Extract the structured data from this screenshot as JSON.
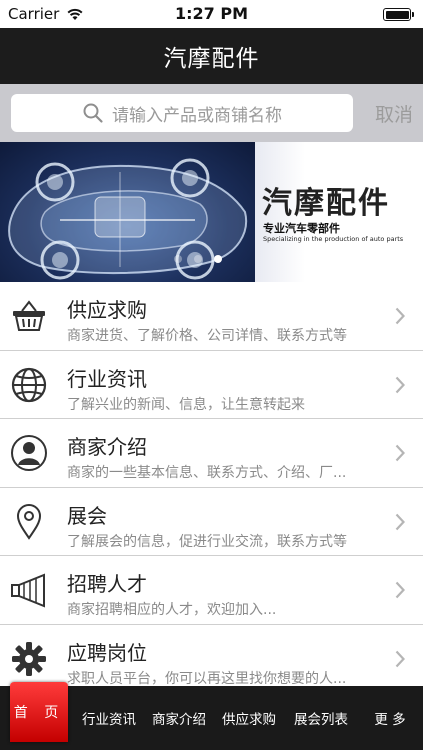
{
  "status_bar": {
    "carrier": "Carrier",
    "time": "1:27 PM"
  },
  "nav": {
    "title": "汽摩配件"
  },
  "search": {
    "placeholder": "请输入产品或商铺名称",
    "cancel_label": "取消"
  },
  "banner": {
    "brand_title": "汽摩配件",
    "brand_subtitle": "专业汽车零部件",
    "brand_english": "Specializing in the production of auto parts",
    "page_count": 3,
    "active_page_index": 2
  },
  "list": [
    {
      "title": "供应求购",
      "desc": "商家进货、了解价格、公司详情、联系方式等",
      "icon": "basket-icon"
    },
    {
      "title": "行业资讯",
      "desc": "了解兴业的新闻、信息，让生意转起来",
      "icon": "globe-icon"
    },
    {
      "title": "商家介绍",
      "desc": "商家的一些基本信息、联系方式、介绍、厂...",
      "icon": "person-icon"
    },
    {
      "title": "展会",
      "desc": "了解展会的信息，促进行业交流，联系方式等",
      "icon": "location-pin-icon"
    },
    {
      "title": "招聘人才",
      "desc": "商家招聘相应的人才，欢迎加入...",
      "icon": "megaphone-icon"
    },
    {
      "title": "应聘岗位",
      "desc": "求职人员平台，你可以再这里找你想要的人...",
      "icon": "gear-icon"
    }
  ],
  "tabs": [
    {
      "label": "首 页",
      "active": true
    },
    {
      "label": "行业资讯"
    },
    {
      "label": "商家介绍"
    },
    {
      "label": "供应求购"
    },
    {
      "label": "展会列表"
    },
    {
      "label": "更  多"
    }
  ],
  "colors": {
    "nav_bg": "#1c1c1c",
    "tab_active": "#e01010",
    "search_bg": "#c9c9ce"
  }
}
